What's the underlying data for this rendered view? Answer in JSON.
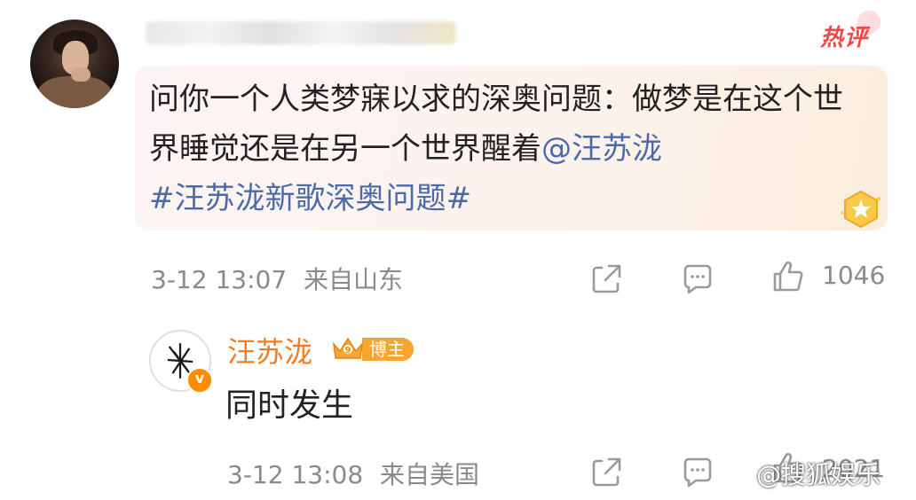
{
  "comment": {
    "badge": "热评",
    "text_main": "问你一个人类梦寐以求的深奥问题：做梦是在这个世界睡觉还是在另一个世界醒着",
    "mention": "@汪苏泷",
    "hashtag": "#汪苏泷新歌深奥问题#",
    "timestamp": "3-12 13:07",
    "location": "来自山东",
    "like_count": "1046"
  },
  "reply": {
    "username": "汪苏泷",
    "vip_level": "9",
    "role_badge": "博主",
    "verified_mark": "v",
    "text": "同时发生",
    "timestamp": "3-12 13:08",
    "location": "来自美国",
    "like_count": "2021"
  },
  "watermark": {
    "text": "@搜狐娱乐"
  },
  "colors": {
    "mention": "#4c6aa8",
    "hot": "#f04848",
    "reply_name": "#f07d22",
    "vip": "#f7a531",
    "meta": "#8a8a8a"
  },
  "icons": {
    "share": "share-icon",
    "comment": "comment-icon",
    "like": "thumbs-up-icon",
    "star": "star-badge-icon",
    "crown": "crown-icon"
  }
}
